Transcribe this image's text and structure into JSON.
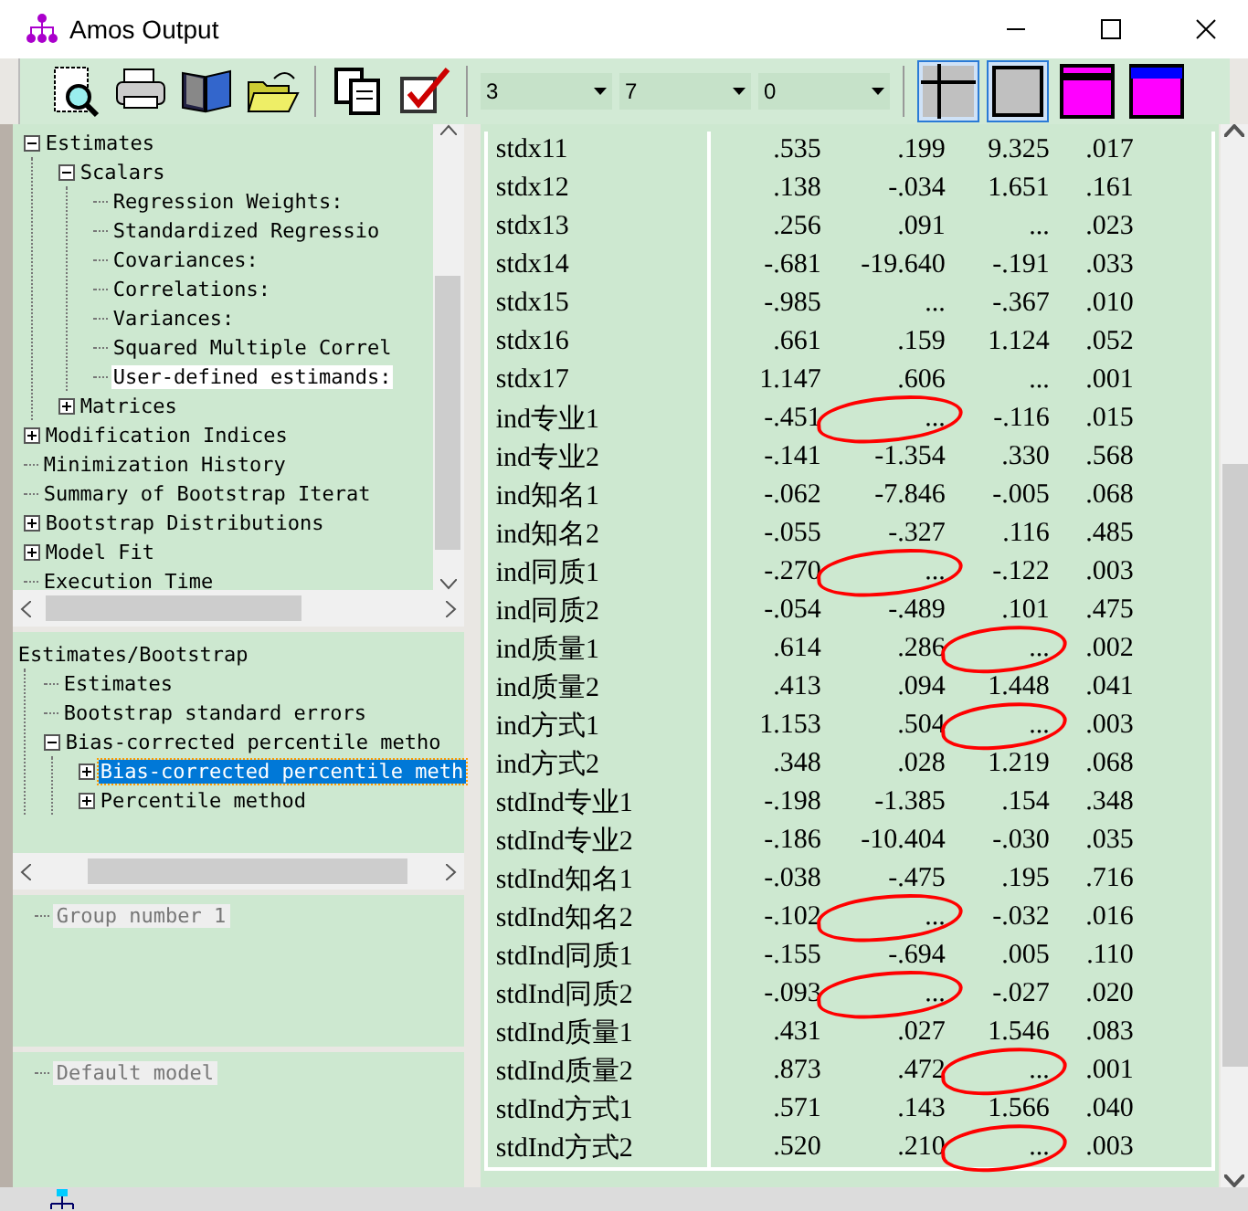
{
  "window": {
    "title": "Amos Output"
  },
  "toolbar": {
    "dropdowns": [
      {
        "value": "3"
      },
      {
        "value": "7"
      },
      {
        "value": "0"
      }
    ],
    "toggles": [
      {
        "kind": "grid",
        "selected": true
      },
      {
        "kind": "frame",
        "selected": true
      },
      {
        "kind": "black-band",
        "selected": false
      },
      {
        "kind": "blue-band",
        "selected": false
      }
    ]
  },
  "tree": [
    {
      "label": "Estimates",
      "expanded": true,
      "children": [
        {
          "label": "Scalars",
          "expanded": true,
          "children": [
            {
              "label": "Regression Weights:",
              "selected": false
            },
            {
              "label": "Standardized Regressio",
              "selected": false
            },
            {
              "label": "Covariances:",
              "selected": false
            },
            {
              "label": "Correlations:",
              "selected": false
            },
            {
              "label": "Variances:",
              "selected": false
            },
            {
              "label": "Squared Multiple Correl",
              "selected": false
            },
            {
              "label": "User-defined estimands:",
              "selected": true
            }
          ]
        },
        {
          "label": "Matrices",
          "expanded": false
        }
      ]
    },
    {
      "label": "Modification Indices",
      "expanded": false
    },
    {
      "label": "Minimization History"
    },
    {
      "label": "Summary of Bootstrap Iterat"
    },
    {
      "label": "Bootstrap Distributions",
      "expanded": false
    },
    {
      "label": "Model Fit",
      "expanded": false
    },
    {
      "label": "Execution Time"
    }
  ],
  "bootstrap_tree": {
    "label": "Estimates/Bootstrap",
    "children": [
      {
        "label": "Estimates",
        "selected": false
      },
      {
        "label": "Bootstrap standard errors",
        "selected": false
      },
      {
        "label": "Bias-corrected percentile metho",
        "expanded": true,
        "selected": false,
        "children": [
          {
            "label": "Bias-corrected percentile meth",
            "expanded": false,
            "selected": true
          },
          {
            "label": "Percentile method",
            "expanded": false,
            "selected": false
          }
        ]
      }
    ]
  },
  "groups": [
    {
      "label": "Group number 1"
    }
  ],
  "models": [
    {
      "label": "Default model"
    }
  ],
  "table": {
    "rows": [
      {
        "name": "stdx11",
        "values": [
          ".535",
          ".199",
          "9.325",
          ".017"
        ],
        "circled": [
          false,
          false,
          false,
          false
        ]
      },
      {
        "name": "stdx12",
        "values": [
          ".138",
          "-.034",
          "1.651",
          ".161"
        ],
        "circled": [
          false,
          false,
          false,
          false
        ]
      },
      {
        "name": "stdx13",
        "values": [
          ".256",
          ".091",
          "...",
          ".023"
        ],
        "circled": [
          false,
          false,
          false,
          false
        ]
      },
      {
        "name": "stdx14",
        "values": [
          "-.681",
          "-19.640",
          "-.191",
          ".033"
        ],
        "circled": [
          false,
          false,
          false,
          false
        ]
      },
      {
        "name": "stdx15",
        "values": [
          "-.985",
          "...",
          "-.367",
          ".010"
        ],
        "circled": [
          false,
          false,
          false,
          false
        ]
      },
      {
        "name": "stdx16",
        "values": [
          ".661",
          ".159",
          "1.124",
          ".052"
        ],
        "circled": [
          false,
          false,
          false,
          false
        ]
      },
      {
        "name": "stdx17",
        "values": [
          "1.147",
          ".606",
          "...",
          ".001"
        ],
        "circled": [
          false,
          false,
          false,
          false
        ]
      },
      {
        "name": "ind专业1",
        "values": [
          "-.451",
          "...",
          "-.116",
          ".015"
        ],
        "circled": [
          false,
          true,
          false,
          false
        ]
      },
      {
        "name": "ind专业2",
        "values": [
          "-.141",
          "-1.354",
          ".330",
          ".568"
        ],
        "circled": [
          false,
          false,
          false,
          false
        ]
      },
      {
        "name": "ind知名1",
        "values": [
          "-.062",
          "-7.846",
          "-.005",
          ".068"
        ],
        "circled": [
          false,
          false,
          false,
          false
        ]
      },
      {
        "name": "ind知名2",
        "values": [
          "-.055",
          "-.327",
          ".116",
          ".485"
        ],
        "circled": [
          false,
          false,
          false,
          false
        ]
      },
      {
        "name": "ind同质1",
        "values": [
          "-.270",
          "...",
          "-.122",
          ".003"
        ],
        "circled": [
          false,
          true,
          false,
          false
        ]
      },
      {
        "name": "ind同质2",
        "values": [
          "-.054",
          "-.489",
          ".101",
          ".475"
        ],
        "circled": [
          false,
          false,
          false,
          false
        ]
      },
      {
        "name": "ind质量1",
        "values": [
          ".614",
          ".286",
          "...",
          ".002"
        ],
        "circled": [
          false,
          false,
          true,
          false
        ]
      },
      {
        "name": "ind质量2",
        "values": [
          ".413",
          ".094",
          "1.448",
          ".041"
        ],
        "circled": [
          false,
          false,
          false,
          false
        ]
      },
      {
        "name": "ind方式1",
        "values": [
          "1.153",
          ".504",
          "...",
          ".003"
        ],
        "circled": [
          false,
          false,
          true,
          false
        ]
      },
      {
        "name": "ind方式2",
        "values": [
          ".348",
          ".028",
          "1.219",
          ".068"
        ],
        "circled": [
          false,
          false,
          false,
          false
        ]
      },
      {
        "name": "stdInd专业1",
        "values": [
          "-.198",
          "-1.385",
          ".154",
          ".348"
        ],
        "circled": [
          false,
          false,
          false,
          false
        ]
      },
      {
        "name": "stdInd专业2",
        "values": [
          "-.186",
          "-10.404",
          "-.030",
          ".035"
        ],
        "circled": [
          false,
          false,
          false,
          false
        ]
      },
      {
        "name": "stdInd知名1",
        "values": [
          "-.038",
          "-.475",
          ".195",
          ".716"
        ],
        "circled": [
          false,
          false,
          false,
          false
        ]
      },
      {
        "name": "stdInd知名2",
        "values": [
          "-.102",
          "...",
          "-.032",
          ".016"
        ],
        "circled": [
          false,
          true,
          false,
          false
        ]
      },
      {
        "name": "stdInd同质1",
        "values": [
          "-.155",
          "-.694",
          ".005",
          ".110"
        ],
        "circled": [
          false,
          false,
          false,
          false
        ]
      },
      {
        "name": "stdInd同质2",
        "values": [
          "-.093",
          "...",
          "-.027",
          ".020"
        ],
        "circled": [
          false,
          true,
          false,
          false
        ]
      },
      {
        "name": "stdInd质量1",
        "values": [
          ".431",
          ".027",
          "1.546",
          ".083"
        ],
        "circled": [
          false,
          false,
          false,
          false
        ]
      },
      {
        "name": "stdInd质量2",
        "values": [
          ".873",
          ".472",
          "...",
          ".001"
        ],
        "circled": [
          false,
          false,
          true,
          false
        ]
      },
      {
        "name": "stdInd方式1",
        "values": [
          ".571",
          ".143",
          "1.566",
          ".040"
        ],
        "circled": [
          false,
          false,
          false,
          false
        ]
      },
      {
        "name": "stdInd方式2",
        "values": [
          ".520",
          ".210",
          "...",
          ".003"
        ],
        "circled": [
          false,
          false,
          true,
          false
        ]
      }
    ]
  }
}
